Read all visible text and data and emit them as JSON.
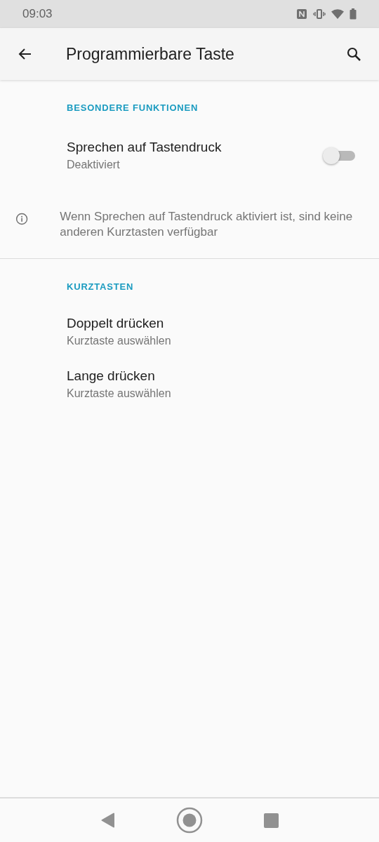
{
  "status_bar": {
    "time": "09:03"
  },
  "app_bar": {
    "title": "Programmierbare Taste"
  },
  "sections": [
    {
      "header": "BESONDERE FUNKTIONEN",
      "items": [
        {
          "kind": "switch",
          "title": "Sprechen auf Tastendruck",
          "subtitle": "Deaktiviert",
          "on": false
        },
        {
          "kind": "info",
          "text": "Wenn Sprechen auf Tastendruck aktiviert ist, sind keine anderen Kurztasten verfügbar"
        }
      ]
    },
    {
      "header": "KURZTASTEN",
      "items": [
        {
          "kind": "entry",
          "title": "Doppelt drücken",
          "subtitle": "Kurztaste auswählen"
        },
        {
          "kind": "entry",
          "title": "Lange drücken",
          "subtitle": "Kurztaste auswählen"
        }
      ]
    }
  ]
}
